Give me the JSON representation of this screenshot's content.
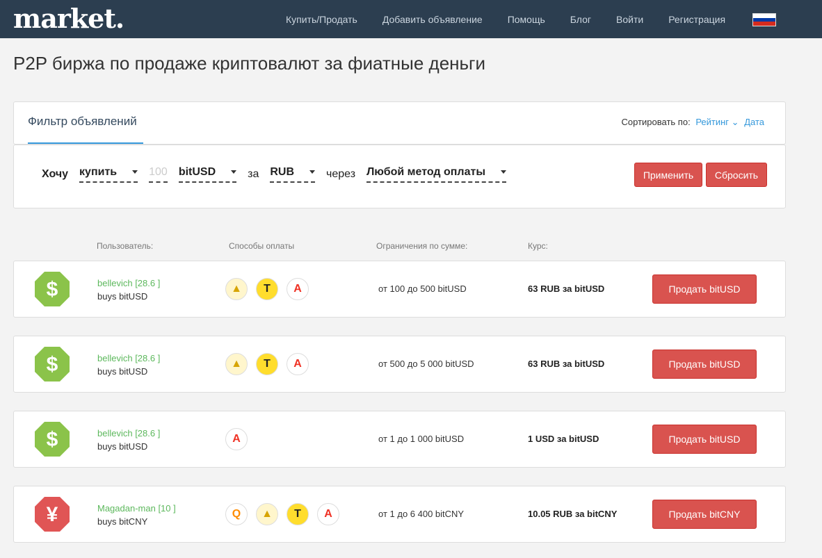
{
  "nav": {
    "logo": "market.",
    "links": [
      "Купить/Продать",
      "Добавить объявление",
      "Помощь",
      "Блог",
      "Войти",
      "Регистрация"
    ]
  },
  "page_title": "P2P биржа по продаже криптовалют за фиатные деньги",
  "filter": {
    "title": "Фильтр объявлений",
    "sort_label": "Сортировать по:",
    "sort_rating": "Рейтинг",
    "sort_date": "Дата",
    "want": "Хочу",
    "action": "купить",
    "amount": "100",
    "currency": "bitUSD",
    "for": "за",
    "fiat": "RUB",
    "via": "через",
    "method": "Любой метод оплаты",
    "apply": "Применить",
    "reset": "Сбросить"
  },
  "columns": {
    "user": "Пользователь:",
    "payment": "Способы оплаты",
    "limits": "Ограничения по сумме:",
    "rate": "Курс:"
  },
  "offers": [
    {
      "user": "bellevich [28.6 ]",
      "buys": "buys bitUSD",
      "icon": "dollar-icon",
      "methods": [
        "yandex",
        "tinkoff",
        "alfa"
      ],
      "limit": "от 100 до 500 bitUSD",
      "rate": "63 RUB за bitUSD",
      "button": "Продать bitUSD"
    },
    {
      "user": "bellevich [28.6 ]",
      "buys": "buys bitUSD",
      "icon": "dollar-icon",
      "methods": [
        "yandex",
        "tinkoff",
        "alfa"
      ],
      "limit": "от 500 до 5 000 bitUSD",
      "rate": "63 RUB за bitUSD",
      "button": "Продать bitUSD"
    },
    {
      "user": "bellevich [28.6 ]",
      "buys": "buys bitUSD",
      "icon": "dollar-icon",
      "methods": [
        "alfa"
      ],
      "limit": "от 1 до 1 000 bitUSD",
      "rate": "1 USD за bitUSD",
      "button": "Продать bitUSD"
    },
    {
      "user": "Magadan-man [10 ]",
      "buys": "buys bitCNY",
      "icon": "yuan-icon",
      "methods": [
        "qiwi",
        "yandex",
        "tinkoff",
        "alfa"
      ],
      "limit": "от 1 до 6 400 bitCNY",
      "rate": "10.05 RUB за bitCNY",
      "button": "Продать bitCNY"
    }
  ],
  "colors": {
    "navbar": "#2c3e50",
    "accent": "#d9534f",
    "link": "#3498db",
    "user": "#5cb85c"
  }
}
